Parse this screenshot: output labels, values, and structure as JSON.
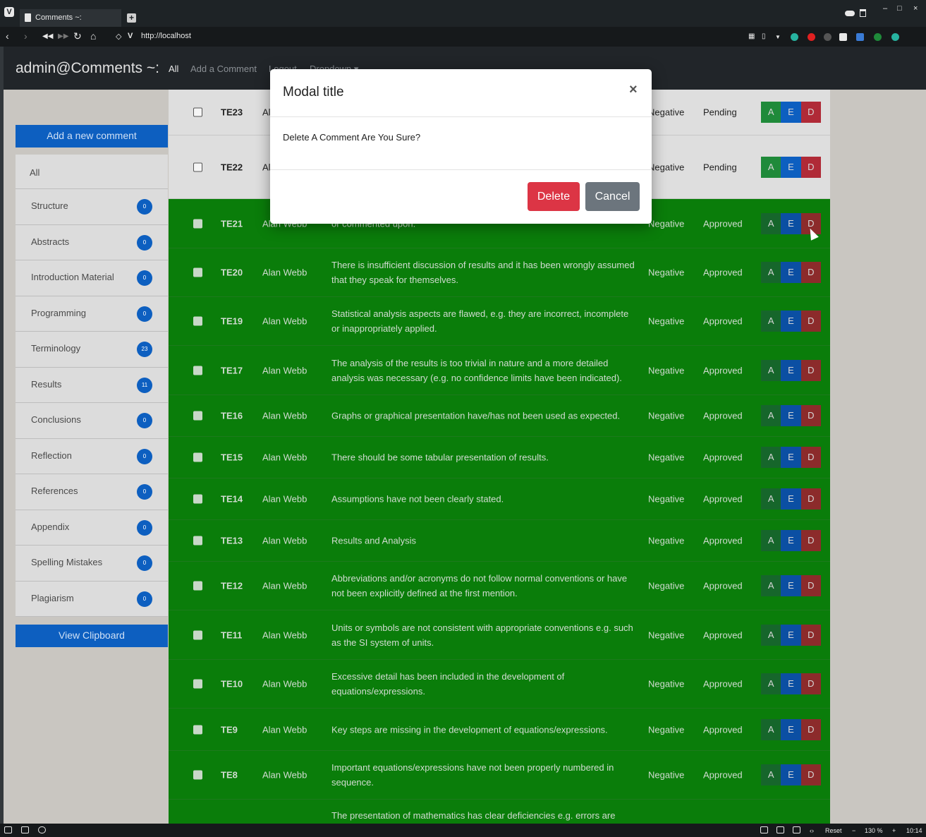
{
  "browser": {
    "tab_title": "Comments ~:",
    "url": "http://localhost",
    "zoom_reset": "Reset",
    "zoom_level": "130 %",
    "clock": "10:14"
  },
  "app": {
    "brand": "admin@Comments ~:",
    "nav": [
      "All",
      "Add a Comment",
      "Logout",
      "Dropdown ▾"
    ]
  },
  "sidebar": {
    "add_button": "Add a new comment",
    "clipboard_button": "View Clipboard",
    "items": [
      {
        "label": "All"
      },
      {
        "label": "Structure",
        "count": "0"
      },
      {
        "label": "Abstracts",
        "count": "0"
      },
      {
        "label": "Introduction Material",
        "count": "0"
      },
      {
        "label": "Programming",
        "count": "0"
      },
      {
        "label": "Terminology",
        "count": "23"
      },
      {
        "label": "Results",
        "count": "11"
      },
      {
        "label": "Conclusions",
        "count": "0"
      },
      {
        "label": "Reflection",
        "count": "0"
      },
      {
        "label": "References",
        "count": "0"
      },
      {
        "label": "Appendix",
        "count": "0"
      },
      {
        "label": "Spelling Mistakes",
        "count": "0"
      },
      {
        "label": "Plagiarism",
        "count": "0"
      }
    ]
  },
  "actions": {
    "a": "A",
    "e": "E",
    "d": "D"
  },
  "rows": [
    {
      "id": "TE23",
      "name": "Al",
      "text": "",
      "type": "Negative",
      "status": "Pending"
    },
    {
      "id": "TE22",
      "name": "Al",
      "text": "",
      "type": "Negative",
      "status": "Pending"
    },
    {
      "id": "TE21",
      "name": "Alan Webb",
      "text": "or commented upon.",
      "type": "Negative",
      "status": "Approved"
    },
    {
      "id": "TE20",
      "name": "Alan Webb",
      "text": "There is insufficient discussion of results and it has been wrongly assumed that they speak for themselves.",
      "type": "Negative",
      "status": "Approved"
    },
    {
      "id": "TE19",
      "name": "Alan Webb",
      "text": "Statistical analysis aspects are flawed, e.g. they are incorrect, incomplete or inappropriately applied.",
      "type": "Negative",
      "status": "Approved"
    },
    {
      "id": "TE17",
      "name": "Alan Webb",
      "text": "The analysis of the results is too trivial in nature and a more detailed analysis was necessary (e.g. no confidence limits have been indicated).",
      "type": "Negative",
      "status": "Approved"
    },
    {
      "id": "TE16",
      "name": "Alan Webb",
      "text": "Graphs or graphical presentation have/has not been used as expected.",
      "type": "Negative",
      "status": "Approved"
    },
    {
      "id": "TE15",
      "name": "Alan Webb",
      "text": "There should be some tabular presentation of results.",
      "type": "Negative",
      "status": "Approved"
    },
    {
      "id": "TE14",
      "name": "Alan Webb",
      "text": "Assumptions have not been clearly stated.",
      "type": "Negative",
      "status": "Approved"
    },
    {
      "id": "TE13",
      "name": "Alan Webb",
      "text": "Results and Analysis",
      "type": "Negative",
      "status": "Approved"
    },
    {
      "id": "TE12",
      "name": "Alan Webb",
      "text": "Abbreviations and/or acronyms do not follow normal conventions or have not been explicitly defined at the first mention.",
      "type": "Negative",
      "status": "Approved"
    },
    {
      "id": "TE11",
      "name": "Alan Webb",
      "text": "Units or symbols are not consistent with appropriate conventions e.g. such as the SI system of units.",
      "type": "Negative",
      "status": "Approved"
    },
    {
      "id": "TE10",
      "name": "Alan Webb",
      "text": "Excessive detail has been included in the development of equations/expressions.",
      "type": "Negative",
      "status": "Approved"
    },
    {
      "id": "TE9",
      "name": "Alan Webb",
      "text": "Key steps are missing in the development of equations/expressions.",
      "type": "Negative",
      "status": "Approved"
    },
    {
      "id": "TE8",
      "name": "Alan Webb",
      "text": "Important equations/expressions have not been properly numbered in sequence.",
      "type": "Negative",
      "status": "Approved"
    },
    {
      "id": "",
      "name": "",
      "text": "The presentation of mathematics has clear deficiencies e.g. errors are",
      "type": "",
      "status": ""
    }
  ],
  "modal": {
    "title": "Modal title",
    "close": "×",
    "body": "Delete A Comment Are You Sure?",
    "delete_label": "Delete",
    "cancel_label": "Cancel"
  },
  "colors": {
    "primary": "#0d5fc0",
    "approved_row": "#0a7d0a",
    "danger": "#dc3545",
    "secondary": "#6c757d"
  }
}
